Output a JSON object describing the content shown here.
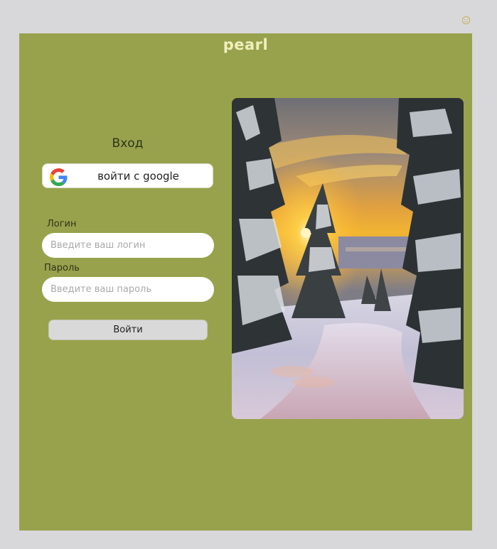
{
  "app": {
    "brand": "pearl"
  },
  "corner": {
    "icon": "smiley-icon"
  },
  "login": {
    "title": "Вход",
    "google_button_label": "войти с google",
    "login_label": "Логин",
    "login_placeholder": "Введите ваш логин",
    "password_label": "Пароль",
    "password_placeholder": "Введите ваш пароль",
    "submit_label": "Войти"
  },
  "photo": {
    "subject": "winter forest road at sunset"
  },
  "colors": {
    "page_bg": "#d8d8da",
    "panel_bg": "#98a24d",
    "brand_text": "#f1efbc",
    "submit_bg": "#d9d9d9"
  }
}
